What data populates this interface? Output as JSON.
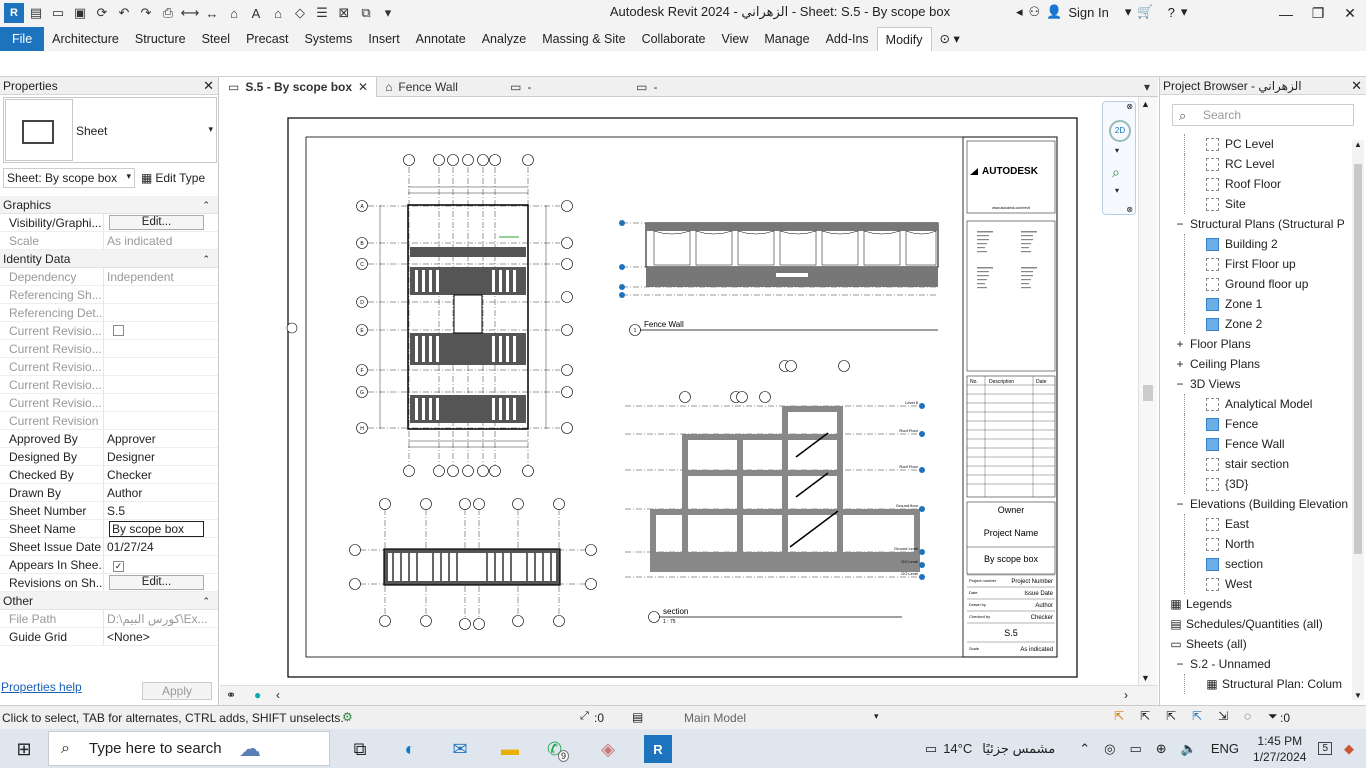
{
  "titlebar": {
    "title": "Autodesk Revit 2024 - الزهراني - Sheet: S.5 - By scope box",
    "sign_in": "Sign In"
  },
  "ribbon": {
    "tabs": [
      "File",
      "Architecture",
      "Structure",
      "Steel",
      "Precast",
      "Systems",
      "Insert",
      "Annotate",
      "Analyze",
      "Massing & Site",
      "Collaborate",
      "View",
      "Manage",
      "Add-Ins",
      "Modify"
    ],
    "active": "Modify"
  },
  "properties": {
    "header": "Properties",
    "type_name": "Sheet",
    "instance": "Sheet: By scope box",
    "edit_type": "Edit Type",
    "groups": {
      "graphics": "Graphics",
      "identity": "Identity Data",
      "other": "Other"
    },
    "rows": {
      "visibility": {
        "k": "Visibility/Graphi...",
        "v": "Edit..."
      },
      "scale": {
        "k": "Scale",
        "v": "As indicated"
      },
      "dependency": {
        "k": "Dependency",
        "v": "Independent"
      },
      "ref_sheet": {
        "k": "Referencing Sh...",
        "v": ""
      },
      "ref_detail": {
        "k": "Referencing Det...",
        "v": ""
      },
      "cur_rev1": {
        "k": "Current Revisio...",
        "v": ""
      },
      "cur_rev2": {
        "k": "Current Revisio...",
        "v": ""
      },
      "cur_rev3": {
        "k": "Current Revisio...",
        "v": ""
      },
      "cur_rev4": {
        "k": "Current Revisio...",
        "v": ""
      },
      "cur_rev5": {
        "k": "Current Revisio...",
        "v": ""
      },
      "cur_rev6": {
        "k": "Current Revision",
        "v": ""
      },
      "approved": {
        "k": "Approved By",
        "v": "Approver"
      },
      "designed": {
        "k": "Designed By",
        "v": "Designer"
      },
      "checked": {
        "k": "Checked By",
        "v": "Checker"
      },
      "drawn": {
        "k": "Drawn By",
        "v": "Author"
      },
      "sheet_num": {
        "k": "Sheet Number",
        "v": "S.5"
      },
      "sheet_name": {
        "k": "Sheet Name",
        "v": "By scope box"
      },
      "issue_date": {
        "k": "Sheet Issue Date",
        "v": "01/27/24"
      },
      "appears": {
        "k": "Appears In Shee...",
        "v": ""
      },
      "revisions": {
        "k": "Revisions on Sh...",
        "v": "Edit..."
      },
      "file_path": {
        "k": "File Path",
        "v": "D:\\كورس البيم\\Ex..."
      },
      "guide_grid": {
        "k": "Guide Grid",
        "v": "<None>"
      }
    },
    "help": "Properties help",
    "apply": "Apply"
  },
  "view_tabs": [
    {
      "label": "S.5 - By scope box",
      "active": true
    },
    {
      "label": "Fence Wall",
      "active": false
    },
    {
      "label": "-",
      "active": false
    },
    {
      "label": "-",
      "active": false
    }
  ],
  "sheet": {
    "title_block": {
      "logo": "AUTODESK",
      "website": "www.autodesk.com/revit",
      "owner": "Owner",
      "project_name": "Project Name",
      "sheet_title": "By scope box",
      "project_number_label": "Project number",
      "project_number": "Project Number",
      "date_label": "Date",
      "date": "Issue Date",
      "drawn_by_label": "Drawn by",
      "drawn_by": "Author",
      "checked_by_label": "Checked by",
      "checked_by": "Checker",
      "sheet_no": "S.5",
      "scale_label": "Scale",
      "scale": "As indicated",
      "rev_headers": [
        "No.",
        "Description",
        "Date"
      ]
    },
    "views": {
      "fence_wall": "Fence Wall",
      "section": "section",
      "section_scale": "1 : 75",
      "view_num": "1"
    },
    "level_labels": [
      "Level 8",
      "Roof Floor",
      "Roof Floor",
      "Ground floor",
      "Ground Level",
      "GO Level",
      "GO Level"
    ],
    "grid_letters": [
      "A",
      "B",
      "C",
      "D",
      "E",
      "F",
      "G",
      "H"
    ]
  },
  "browser": {
    "header": "Project Browser - الزهراني",
    "search_placeholder": "Search",
    "items": [
      {
        "label": "PC Level",
        "level": 2,
        "icon": "view",
        "blue": false
      },
      {
        "label": "RC Level",
        "level": 2,
        "icon": "view",
        "blue": false
      },
      {
        "label": "Roof Floor",
        "level": 2,
        "icon": "view",
        "blue": false
      },
      {
        "label": "Site",
        "level": 2,
        "icon": "view",
        "blue": false
      },
      {
        "label": "Structural Plans (Structural P",
        "level": 1,
        "icon": "minus"
      },
      {
        "label": "Building 2",
        "level": 2,
        "icon": "view",
        "blue": true
      },
      {
        "label": "First Floor up",
        "level": 2,
        "icon": "view",
        "blue": false
      },
      {
        "label": "Ground floor up",
        "level": 2,
        "icon": "view",
        "blue": false
      },
      {
        "label": "Zone 1",
        "level": 2,
        "icon": "view",
        "blue": true
      },
      {
        "label": "Zone 2",
        "level": 2,
        "icon": "view",
        "blue": true
      },
      {
        "label": "Floor Plans",
        "level": 1,
        "icon": "plus"
      },
      {
        "label": "Ceiling Plans",
        "level": 1,
        "icon": "plus"
      },
      {
        "label": "3D Views",
        "level": 1,
        "icon": "minus"
      },
      {
        "label": "Analytical Model",
        "level": 2,
        "icon": "view",
        "blue": false
      },
      {
        "label": "Fence",
        "level": 2,
        "icon": "view",
        "blue": true
      },
      {
        "label": "Fence Wall",
        "level": 2,
        "icon": "view",
        "blue": true
      },
      {
        "label": "stair section",
        "level": 2,
        "icon": "view",
        "blue": false
      },
      {
        "label": "{3D}",
        "level": 2,
        "icon": "view",
        "blue": false
      },
      {
        "label": "Elevations (Building Elevation",
        "level": 1,
        "icon": "minus"
      },
      {
        "label": "East",
        "level": 2,
        "icon": "view",
        "blue": false
      },
      {
        "label": "North",
        "level": 2,
        "icon": "view",
        "blue": false
      },
      {
        "label": "section",
        "level": 2,
        "icon": "view",
        "blue": true
      },
      {
        "label": "West",
        "level": 2,
        "icon": "view",
        "blue": false
      },
      {
        "label": "Legends",
        "level": 0,
        "icon": "legend"
      },
      {
        "label": "Schedules/Quantities (all)",
        "level": 0,
        "icon": "schedule"
      },
      {
        "label": "Sheets (all)",
        "level": 0,
        "icon": "sheet-minus"
      },
      {
        "label": "S.2 - Unnamed",
        "level": 1,
        "icon": "minus"
      },
      {
        "label": "Structural Plan: Colum",
        "level": 2,
        "icon": "plan"
      }
    ]
  },
  "status": {
    "message": "Click to select, TAB for alternates, CTRL adds, SHIFT unselects.",
    "selection_count": ":0",
    "model": "Main Model",
    "filter_count": ":0"
  },
  "taskbar": {
    "search_placeholder": "Type here to search",
    "weather_temp": "14°C",
    "weather_desc": "مشمس جزئيًا",
    "language": "ENG",
    "time": "1:45 PM",
    "date": "1/27/2024",
    "notifications": "5",
    "whatsapp_badge": "9"
  }
}
